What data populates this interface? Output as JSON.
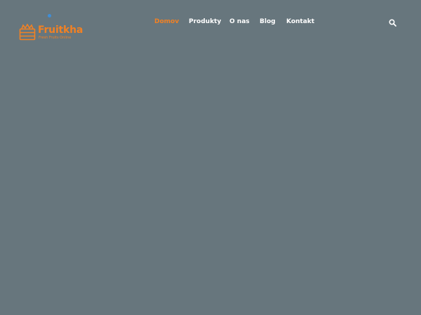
{
  "brand": {
    "name": "Fruitkha",
    "tagline": "Fresh Fruits Online",
    "icon": "fruit-basket-icon",
    "accent_color": "#f28123",
    "dot_color": "#3f8ed8"
  },
  "nav": {
    "items": [
      {
        "label": "Domov",
        "active": true
      },
      {
        "label": "Produkty",
        "active": false
      },
      {
        "label": "O nas",
        "active": false
      },
      {
        "label": "Blog",
        "active": false
      },
      {
        "label": "Kontakt",
        "active": false
      }
    ],
    "search_icon": "search-icon"
  },
  "theme": {
    "background": "#67767d",
    "nav_text": "#ffffff"
  }
}
